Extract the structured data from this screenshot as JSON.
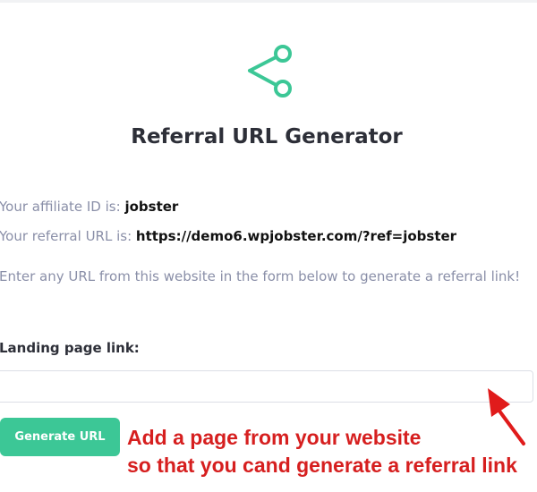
{
  "header": {
    "title": "Referral URL Generator",
    "icon": "share-icon",
    "icon_color": "#3cc796"
  },
  "info": {
    "affiliate_label": "Your affiliate ID is:",
    "affiliate_value": "jobster",
    "referral_label": "Your referral URL is:",
    "referral_value": "https://demo6.wpjobster.com/?ref=jobster"
  },
  "form": {
    "instructions": "Enter any URL from this website in the form below to generate a referral link!",
    "field_label": "Landing page link:",
    "input_value": "",
    "input_placeholder": "",
    "button_label": "Generate URL",
    "button_color": "#3cc796"
  },
  "annotation": {
    "line1": "Add a page from your website",
    "line2": "so that you cand generate a referral link",
    "color": "#d61f1f"
  }
}
